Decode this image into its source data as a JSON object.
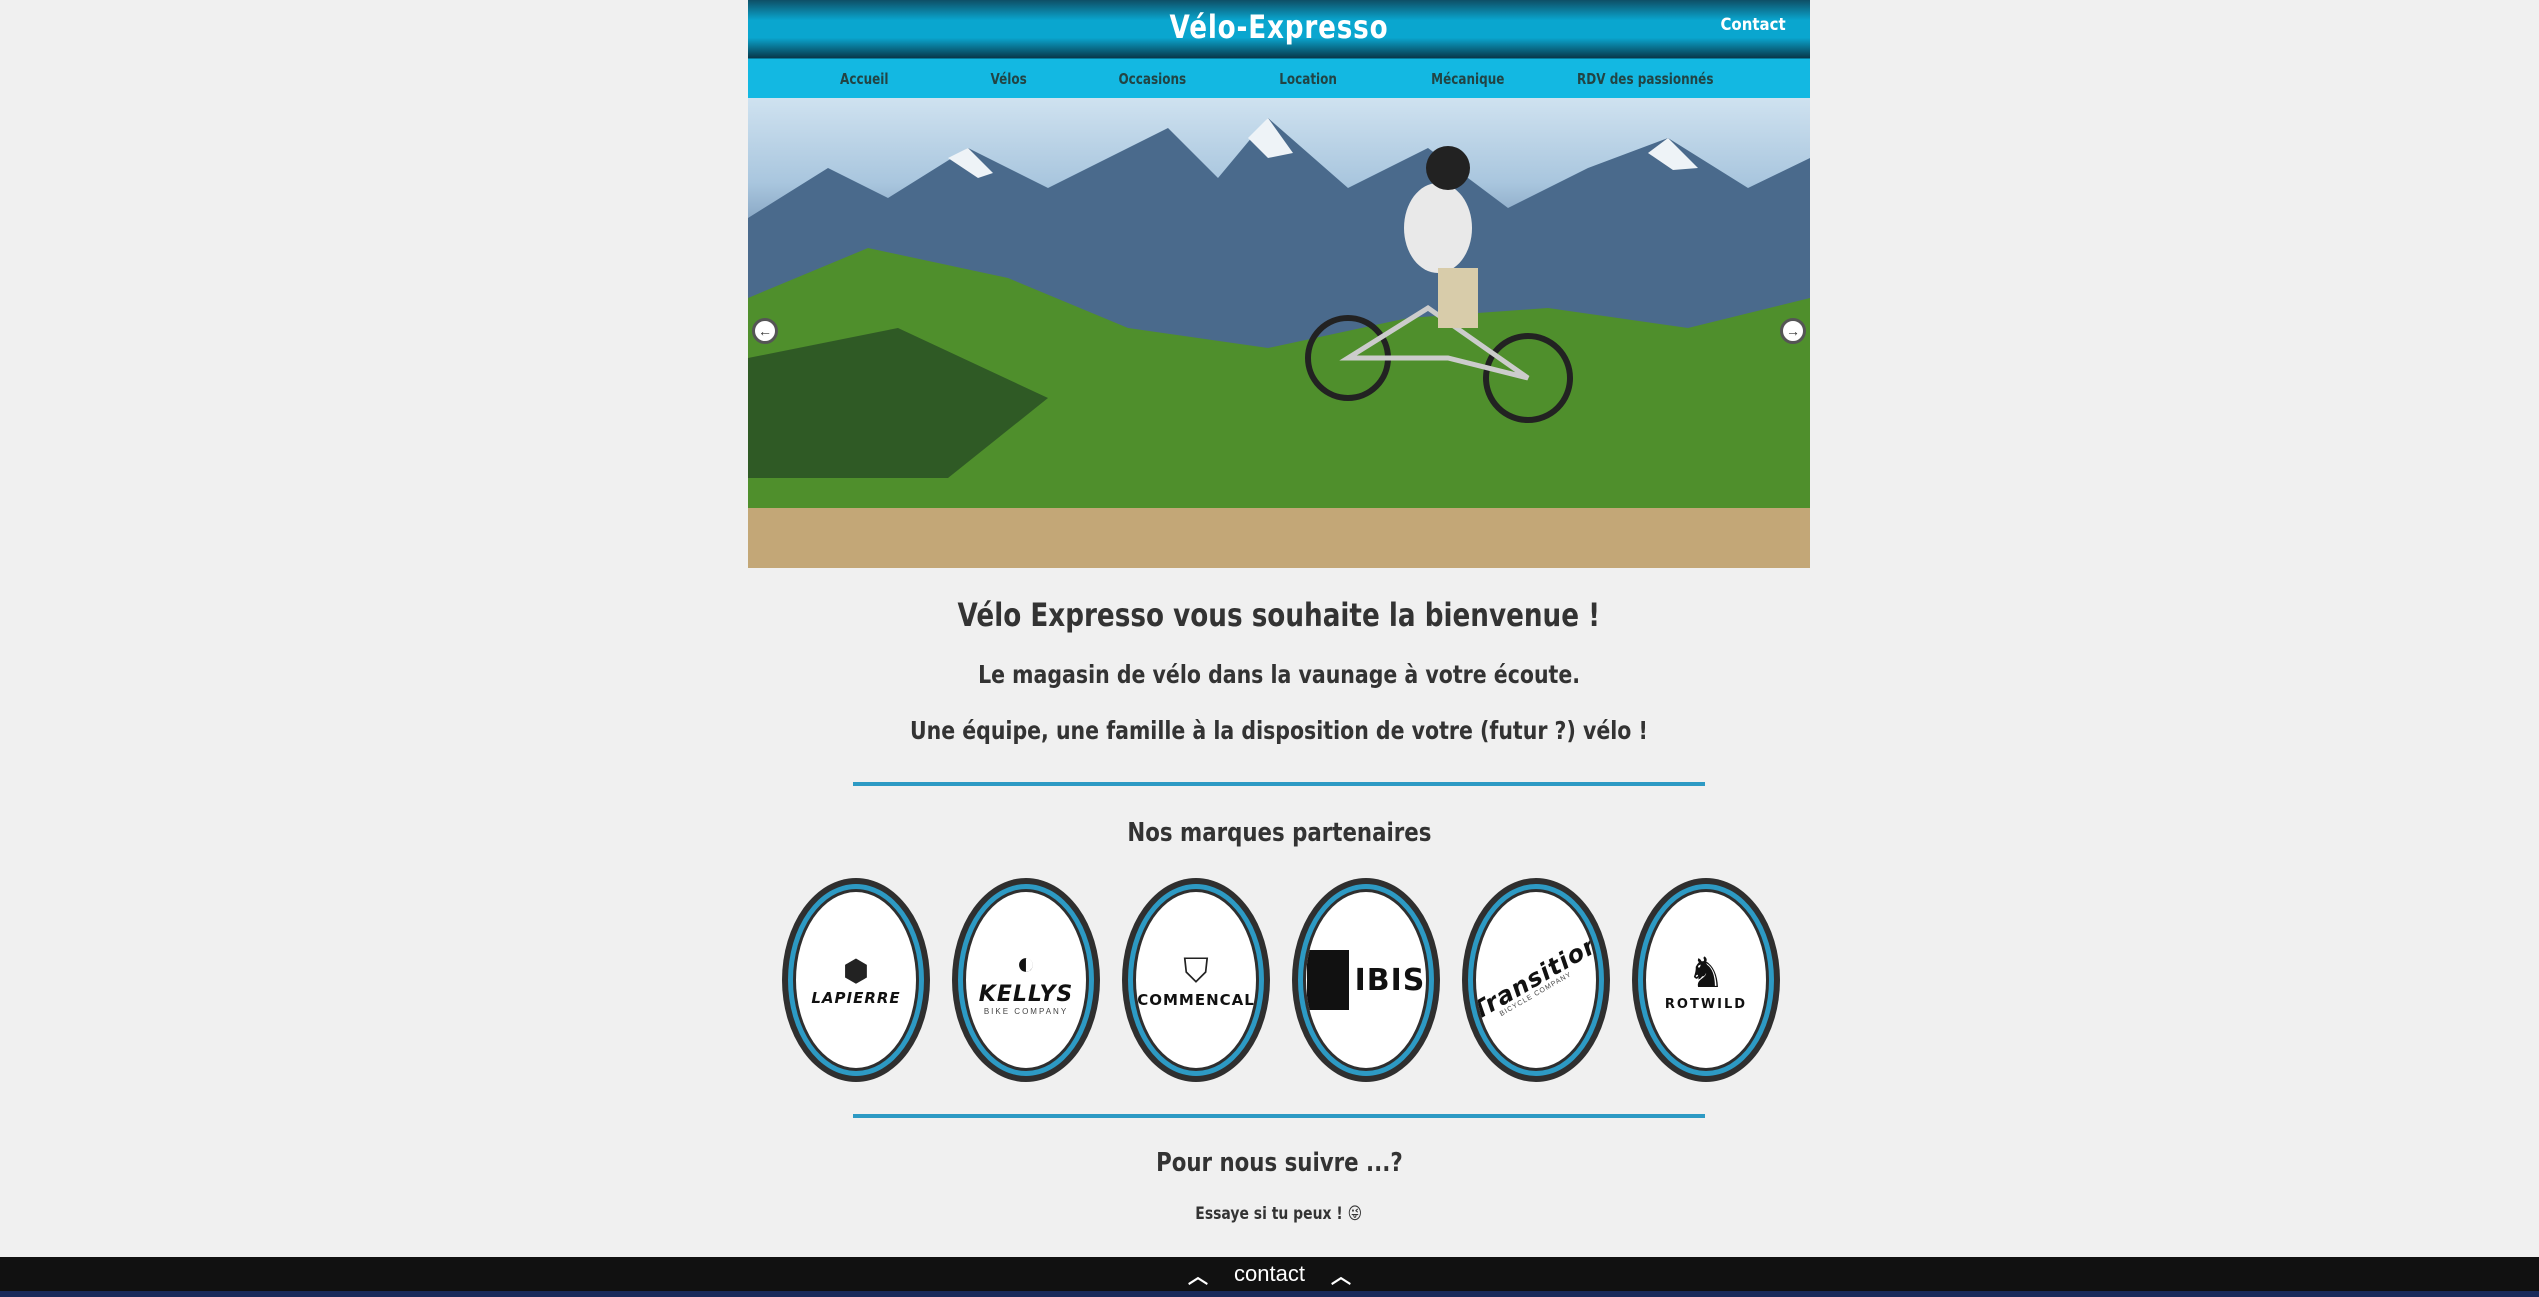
{
  "header": {
    "title": "Vélo-Expresso",
    "contact_label": "Contact"
  },
  "nav": {
    "items": [
      {
        "label": "Accueil"
      },
      {
        "label": "Vélos"
      },
      {
        "label": "Occasions"
      },
      {
        "label": "Location"
      },
      {
        "label": "Mécanique"
      },
      {
        "label": "RDV des passionnés"
      }
    ]
  },
  "slider": {
    "prev_icon": "arrow-left-icon",
    "next_icon": "arrow-right-icon"
  },
  "main": {
    "welcome": "Vélo Expresso vous souhaite la bienvenue !",
    "tagline": "Le magasin de vélo dans la vaunage à votre écoute.",
    "family": "Une équipe, une famille à la disposition de votre (futur ?) vélo !",
    "partners_title": "Nos marques partenaires",
    "brands": [
      {
        "name": "LAPIERRE"
      },
      {
        "name": "KELLYS",
        "sub": "BIKE COMPANY"
      },
      {
        "name": "COMMENCAL"
      },
      {
        "name": "IBIS"
      },
      {
        "name": "Transition",
        "sub": "BICYCLE COMPANY"
      },
      {
        "name": "ROTWILD"
      }
    ],
    "follow_title": "Pour nous suivre ...?",
    "follow_sub": "Essaye si tu peux ! 😜"
  },
  "footer": {
    "label": "contact"
  },
  "colors": {
    "accent": "#13b8e2",
    "rule": "#2d9ac4",
    "footer_bg": "#111111"
  }
}
